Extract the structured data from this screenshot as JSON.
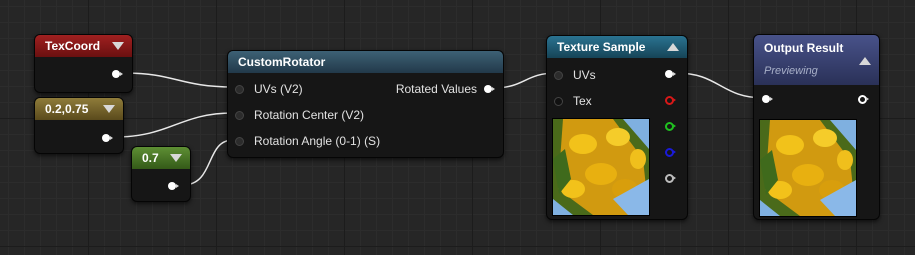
{
  "nodes": {
    "texcoord": {
      "title": "TexCoord",
      "color": "#8a1a1a"
    },
    "const2": {
      "title": "0.2,0.75",
      "color": "#7a6a30"
    },
    "const1": {
      "title": "0.7",
      "color": "#4d7a2a"
    },
    "custom": {
      "title": "CustomRotator",
      "color": "#2f4c5e",
      "inputs": [
        "UVs (V2)",
        "Rotation Center (V2)",
        "Rotation Angle (0-1) (S)"
      ],
      "output": "Rotated Values"
    },
    "texture": {
      "title": "Texture Sample",
      "color": "#1f5a74",
      "inputs": [
        "UVs",
        "Tex"
      ]
    },
    "output": {
      "title": "Output Result",
      "subtitle": "Previewing",
      "color": "#3a4470"
    }
  },
  "icons": {
    "collapse_down": "chevron-down-icon",
    "collapse_up": "chevron-up-icon",
    "pin_colors": [
      "#ffffff",
      "#d81818",
      "#20c020",
      "#1a1ad8",
      "#bdbdbd"
    ]
  }
}
